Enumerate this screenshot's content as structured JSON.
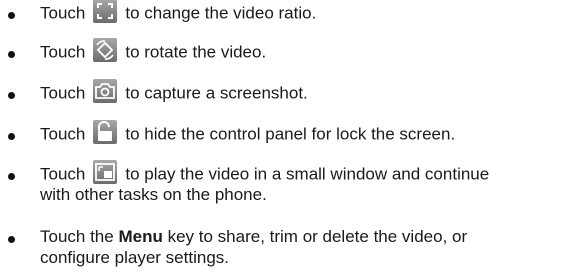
{
  "items": [
    {
      "before": "Touch",
      "icon": "aspect-ratio-icon",
      "after": "to change the video ratio."
    },
    {
      "before": "Touch",
      "icon": "rotate-icon",
      "after": "to rotate the video."
    },
    {
      "before": "Touch",
      "icon": "camera-icon",
      "after": "to capture a screenshot."
    },
    {
      "before": "Touch",
      "icon": "lock-icon",
      "after": "to hide the control panel for lock the screen."
    },
    {
      "before": "Touch",
      "icon": "pop-out-window-icon",
      "after": "to play the video in a small window and continue",
      "after2": "with other tasks on the phone."
    },
    {
      "before": "Touch the",
      "bold": "Menu",
      "after": "key to share, trim or delete the video, or",
      "after2": "configure player settings."
    }
  ]
}
